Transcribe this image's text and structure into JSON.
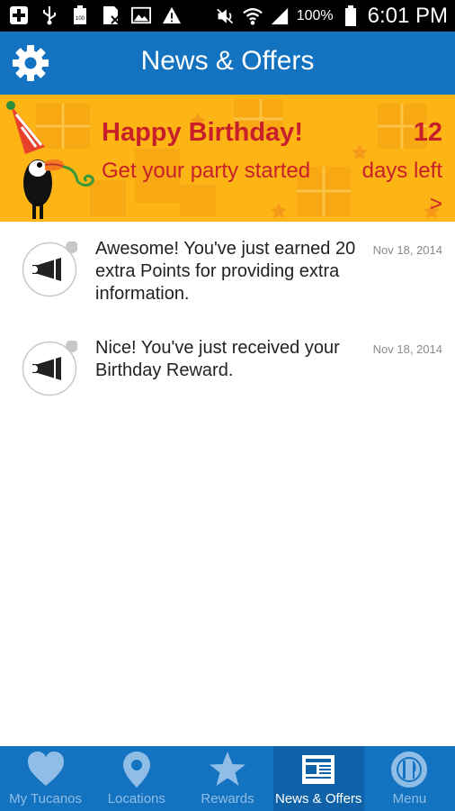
{
  "status_bar": {
    "battery": "100%",
    "time": "6:01 PM",
    "battery_small": "100"
  },
  "header": {
    "title": "News & Offers"
  },
  "banner": {
    "title": "Happy Birthday!",
    "subtitle": "Get your party started",
    "days_count": "12",
    "days_label": "days left",
    "chevron": ">"
  },
  "news": [
    {
      "text": "Awesome! You've just earned 20 extra Points for providing extra information.",
      "date": "Nov 18, 2014"
    },
    {
      "text": "Nice! You've just received your Birthday Reward.",
      "date": "Nov 18, 2014"
    }
  ],
  "bottom_nav": [
    {
      "label": "My Tucanos",
      "icon": "heart-icon",
      "active": false
    },
    {
      "label": "Locations",
      "icon": "location-pin-icon",
      "active": false
    },
    {
      "label": "Rewards",
      "icon": "star-icon",
      "active": false
    },
    {
      "label": "News & Offers",
      "icon": "newspaper-icon",
      "active": true
    },
    {
      "label": "Menu",
      "icon": "plate-icon",
      "active": false
    }
  ],
  "colors": {
    "header_blue": "#1473c0",
    "banner_yellow": "#fdb515",
    "banner_text_red": "#c8202a"
  }
}
